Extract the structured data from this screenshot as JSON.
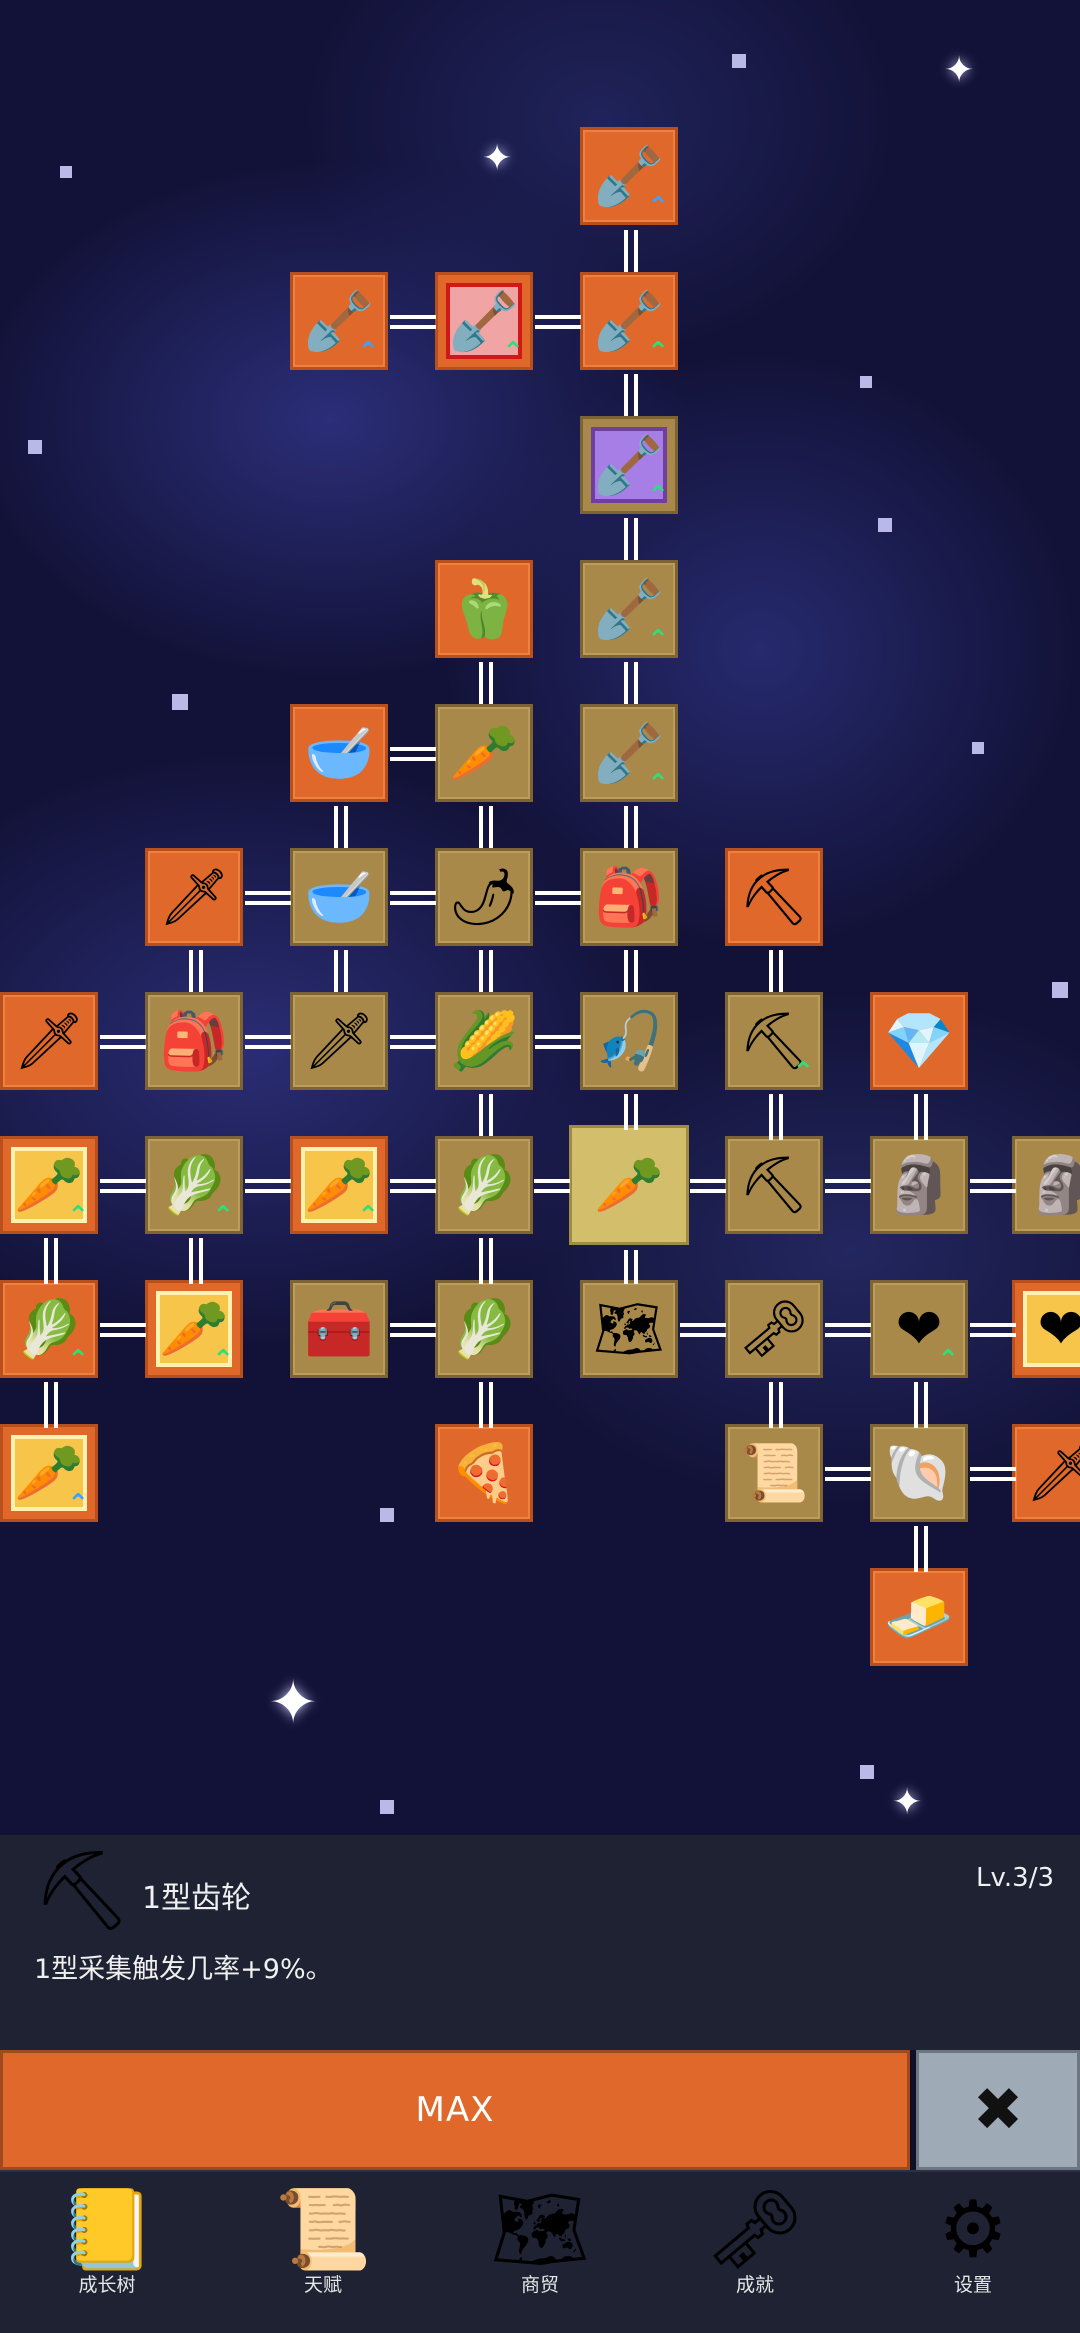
{
  "selected_skill": {
    "icon": "pickaxe-icon",
    "title": "1型齿轮",
    "level": "Lv.3/3",
    "description": "1型采集触发几率+9%。"
  },
  "buttons": {
    "max_label": "MAX",
    "close_icon": "close-icon",
    "close_glyph": "✖"
  },
  "nav": [
    {
      "label": "成长树",
      "icon": "book-icon",
      "glyph": "📒"
    },
    {
      "label": "天赋",
      "icon": "scroll-icon",
      "glyph": "📜"
    },
    {
      "label": "商贸",
      "icon": "map-icon",
      "glyph": "🗺"
    },
    {
      "label": "成就",
      "icon": "key-icon",
      "glyph": "🗝"
    },
    {
      "label": "设置",
      "icon": "gear-icon",
      "glyph": "⚙"
    }
  ],
  "skill_nodes": [
    {
      "name": "shovel",
      "glyph": "🪏",
      "style": "o",
      "upgrade": "b"
    },
    {
      "name": "shovel",
      "glyph": "🪏",
      "style": "o",
      "upgrade": "b"
    },
    {
      "name": "shovel",
      "glyph": "🪏",
      "style": "r",
      "upgrade": "g"
    },
    {
      "name": "shovel",
      "glyph": "🪏",
      "style": "o",
      "upgrade": "g"
    },
    {
      "name": "shovel",
      "glyph": "🪏",
      "style": "p",
      "upgrade": "g"
    },
    {
      "name": "bell-pepper",
      "glyph": "🫑",
      "style": "o",
      "upgrade": ""
    },
    {
      "name": "shovel",
      "glyph": "🪏",
      "style": "g",
      "upgrade": "g"
    },
    {
      "name": "bowl",
      "glyph": "🥣",
      "style": "o",
      "upgrade": ""
    },
    {
      "name": "radish",
      "glyph": "🥕",
      "style": "g",
      "upgrade": ""
    },
    {
      "name": "shovel",
      "glyph": "🪏",
      "style": "g",
      "upgrade": "g"
    },
    {
      "name": "sword",
      "glyph": "🗡",
      "style": "o",
      "upgrade": ""
    },
    {
      "name": "bowl",
      "glyph": "🥣",
      "style": "g",
      "upgrade": ""
    },
    {
      "name": "chili",
      "glyph": "🌶",
      "style": "g",
      "upgrade": ""
    },
    {
      "name": "backpack",
      "glyph": "🎒",
      "style": "g",
      "upgrade": ""
    },
    {
      "name": "pickaxe",
      "glyph": "⛏",
      "style": "o",
      "upgrade": ""
    },
    {
      "name": "sword",
      "glyph": "🗡",
      "style": "o",
      "upgrade": ""
    },
    {
      "name": "backpack",
      "glyph": "🎒",
      "style": "g",
      "upgrade": ""
    },
    {
      "name": "sword",
      "glyph": "🗡",
      "style": "g",
      "upgrade": ""
    },
    {
      "name": "corn",
      "glyph": "🌽",
      "style": "g",
      "upgrade": ""
    },
    {
      "name": "fishing-rod",
      "glyph": "🎣",
      "style": "g",
      "upgrade": ""
    },
    {
      "name": "pickaxe",
      "glyph": "⛏",
      "style": "g",
      "upgrade": "g"
    },
    {
      "name": "crystal",
      "glyph": "💎",
      "style": "o",
      "upgrade": ""
    },
    {
      "name": "carrot",
      "glyph": "🥕",
      "style": "y",
      "upgrade": "g"
    },
    {
      "name": "cabbage",
      "glyph": "🥬",
      "style": "g",
      "upgrade": "g"
    },
    {
      "name": "carrot",
      "glyph": "🥕",
      "style": "y",
      "upgrade": "g"
    },
    {
      "name": "cabbage",
      "glyph": "🥬",
      "style": "g",
      "upgrade": ""
    },
    {
      "name": "carrot",
      "glyph": "🥕",
      "style": "sel",
      "upgrade": ""
    },
    {
      "name": "pickaxe",
      "glyph": "⛏",
      "style": "g",
      "upgrade": ""
    },
    {
      "name": "statue",
      "glyph": "🗿",
      "style": "g",
      "upgrade": ""
    },
    {
      "name": "statue",
      "glyph": "🗿",
      "style": "g",
      "upgrade": ""
    },
    {
      "name": "cabbage",
      "glyph": "🥬",
      "style": "o",
      "upgrade": "g"
    },
    {
      "name": "carrot",
      "glyph": "🥕",
      "style": "y",
      "upgrade": "g"
    },
    {
      "name": "chest",
      "glyph": "🧰",
      "style": "g",
      "upgrade": ""
    },
    {
      "name": "leek",
      "glyph": "🥬",
      "style": "g",
      "upgrade": ""
    },
    {
      "name": "map",
      "glyph": "🗺",
      "style": "g",
      "upgrade": ""
    },
    {
      "name": "key",
      "glyph": "🗝",
      "style": "g",
      "upgrade": ""
    },
    {
      "name": "heart",
      "glyph": "❤",
      "style": "g",
      "upgrade": "g"
    },
    {
      "name": "heart",
      "glyph": "❤",
      "style": "y",
      "upgrade": ""
    },
    {
      "name": "carrot",
      "glyph": "🥕",
      "style": "y",
      "upgrade": "b"
    },
    {
      "name": "pizza",
      "glyph": "🍕",
      "style": "o",
      "upgrade": ""
    },
    {
      "name": "scroll",
      "glyph": "📜",
      "style": "g",
      "upgrade": ""
    },
    {
      "name": "fossil",
      "glyph": "🐚",
      "style": "g",
      "upgrade": ""
    },
    {
      "name": "sword",
      "glyph": "🗡",
      "style": "o",
      "upgrade": ""
    },
    {
      "name": "gold-bar",
      "glyph": "🧈",
      "style": "o",
      "upgrade": ""
    }
  ]
}
